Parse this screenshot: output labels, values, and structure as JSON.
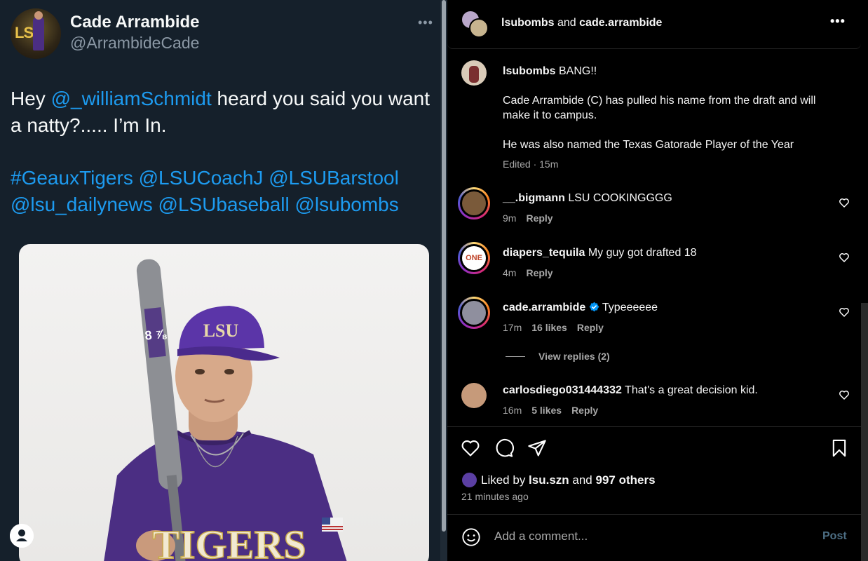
{
  "tweet": {
    "name": "Cade Arrambide",
    "handle": "@ArrambideCade",
    "more": "•••",
    "text_prefix": "Hey ",
    "mention": "@_williamSchmidt",
    "text_suffix": " heard you said you want a natty?..... I’m In.",
    "tags_line1": "#GeauxTigers @LSUCoachJ @LSUBarstool",
    "tags_line2": "@lsu_dailynews @LSUbaseball @lsubombs",
    "photo": {
      "cap_logo": "LSU",
      "jersey_text": "TIGERS",
      "bat_brand": "8 ⅞"
    }
  },
  "ig": {
    "header": {
      "user1": "lsubombs",
      "and": " and ",
      "user2": "cade.arrambide",
      "more": "•••"
    },
    "caption": {
      "user": "lsubombs",
      "text": " BANG!!",
      "para1": "Cade Arrambide (C) has pulled his name from the draft and will make it to campus.",
      "para2": "He was also named the Texas Gatorade Player of the Year",
      "meta": "Edited · 15m"
    },
    "comments": [
      {
        "user": "__.bigmann",
        "text": " LSU COOKINGGGG",
        "time": "9m",
        "likes": "",
        "reply": "Reply"
      },
      {
        "user": "diapers_tequila",
        "text": " My guy got drafted 18",
        "time": "4m",
        "likes": "",
        "reply": "Reply",
        "avatar_text": "ONE"
      },
      {
        "user": "cade.arrambide",
        "text": " Typeeeeee",
        "time": "17m",
        "likes": "16 likes",
        "reply": "Reply",
        "view_replies": "View replies (2)"
      },
      {
        "user": "carlosdiego031444332",
        "text": " That's a great decision kid.",
        "time": "16m",
        "likes": "5 likes",
        "reply": "Reply"
      }
    ],
    "liked": {
      "prefix": "Liked by ",
      "user": "lsu.szn",
      "mid": " and ",
      "others": "997 others"
    },
    "time_ago": "21 minutes ago",
    "comment_placeholder": "Add a comment...",
    "post_label": "Post",
    "colors": {
      "accent_blue": "#1d9bf0",
      "verified": "#0095f6",
      "post_disabled": "#4d6f85",
      "lsu_purple": "#4b2e83"
    }
  }
}
